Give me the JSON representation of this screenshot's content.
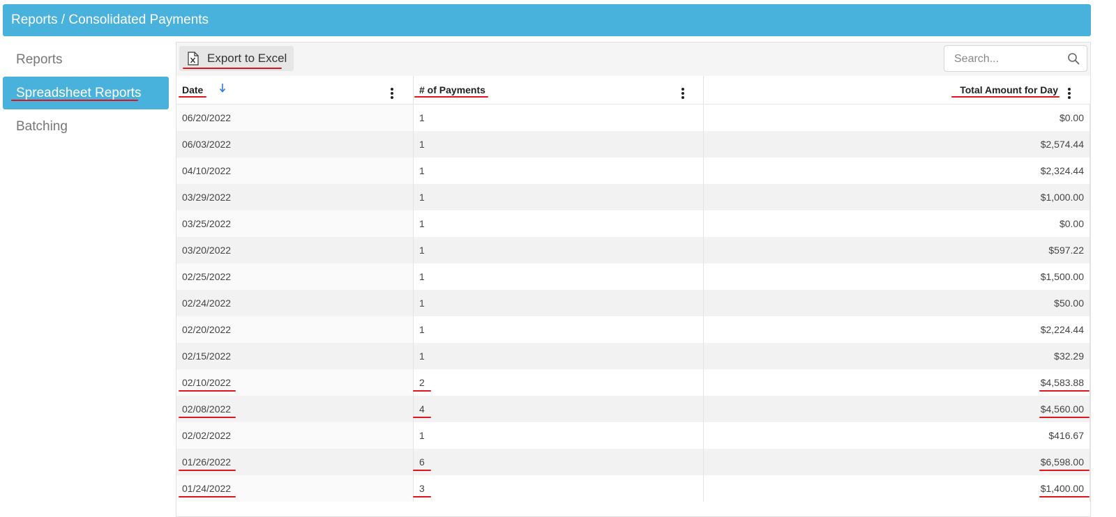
{
  "header": {
    "breadcrumb": "Reports / Consolidated Payments",
    "color": "#48b2dd"
  },
  "sidebar": {
    "items": [
      {
        "label": "Reports",
        "active": false
      },
      {
        "label": "Spreadsheet Reports",
        "active": true
      },
      {
        "label": "Batching",
        "active": false
      }
    ]
  },
  "toolbar": {
    "export_label": "Export to Excel",
    "export_icon": "excel-file-icon",
    "search_placeholder": "Search...",
    "search_icon": "search-icon"
  },
  "table": {
    "columns": [
      {
        "label": "Date",
        "sort": "descending",
        "menu_icon": "kebab-menu-icon"
      },
      {
        "label": "# of Payments",
        "menu_icon": "kebab-menu-icon"
      },
      {
        "label": "Total Amount for Day",
        "menu_icon": "kebab-menu-icon"
      }
    ],
    "rows": [
      {
        "date": "06/20/2022",
        "count": "1",
        "total": "$0.00"
      },
      {
        "date": "06/03/2022",
        "count": "1",
        "total": "$2,574.44"
      },
      {
        "date": "04/10/2022",
        "count": "1",
        "total": "$2,324.44"
      },
      {
        "date": "03/29/2022",
        "count": "1",
        "total": "$1,000.00"
      },
      {
        "date": "03/25/2022",
        "count": "1",
        "total": "$0.00"
      },
      {
        "date": "03/20/2022",
        "count": "1",
        "total": "$597.22"
      },
      {
        "date": "02/25/2022",
        "count": "1",
        "total": "$1,500.00"
      },
      {
        "date": "02/24/2022",
        "count": "1",
        "total": "$50.00"
      },
      {
        "date": "02/20/2022",
        "count": "1",
        "total": "$2,224.44"
      },
      {
        "date": "02/15/2022",
        "count": "1",
        "total": "$32.29"
      },
      {
        "date": "02/10/2022",
        "count": "2",
        "total": "$4,583.88"
      },
      {
        "date": "02/08/2022",
        "count": "4",
        "total": "$4,560.00"
      },
      {
        "date": "02/02/2022",
        "count": "1",
        "total": "$416.67"
      },
      {
        "date": "01/26/2022",
        "count": "6",
        "total": "$6,598.00"
      },
      {
        "date": "01/24/2022",
        "count": "3",
        "total": "$1,400.00"
      }
    ]
  },
  "annotations": {
    "color": "#e0141e"
  }
}
